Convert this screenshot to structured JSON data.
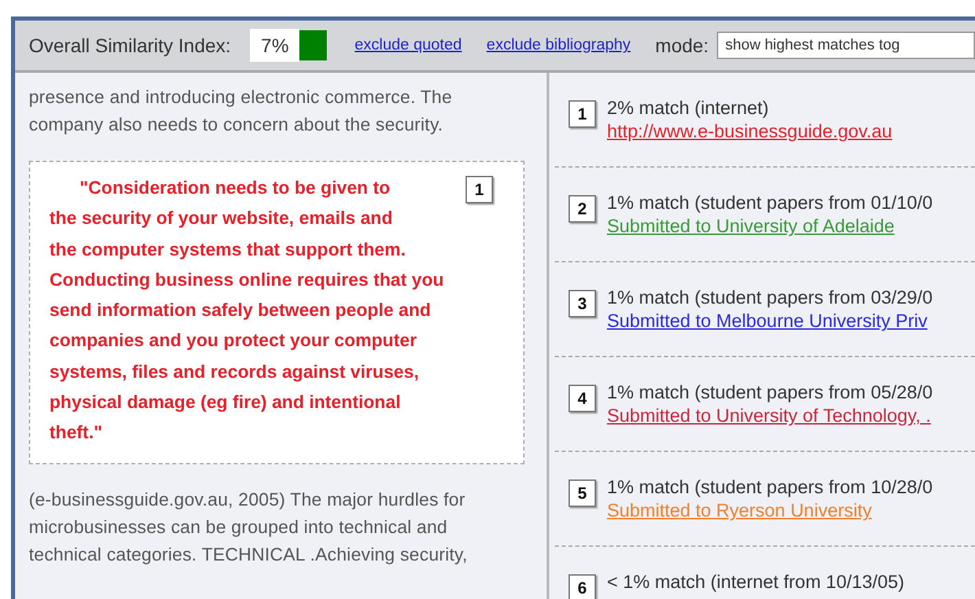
{
  "header": {
    "label": "Overall Similarity Index:",
    "index_value": "7%",
    "links": [
      "exclude quoted",
      "exclude bibliography"
    ],
    "mode_label": "mode:",
    "mode_value": "show highest matches tog"
  },
  "document": [
    {
      "kind": "text",
      "text": "presence and introducing electronic commerce. The\ncompany also needs to concern about the security."
    },
    {
      "kind": "quote",
      "number": "1",
      "color": "#e8202a",
      "text": "\"Consideration needs to be given to\nthe security of your website, emails and\nthe computer systems that support them.\nConducting business online requires that you\nsend information safely between people and\ncompanies and you protect your computer\nsystems, files and records against viruses,\nphysical damage (eg fire) and intentional\ntheft.\""
    },
    {
      "kind": "text",
      "text": "(e-businessguide.gov.au, 2005) The major hurdles for\nmicrobusinesses can be grouped into technical and\ntechnical categories. TECHNICAL .Achieving security,"
    }
  ],
  "matches": [
    {
      "number": "1",
      "summary": "2% match (internet)",
      "source": "http://www.e-businessguide.gov.au",
      "color": "#e8202a"
    },
    {
      "number": "2",
      "summary": "1% match (student papers from 01/10/0",
      "source": "Submitted to University of Adelaide",
      "color": "#3a9a3a"
    },
    {
      "number": "3",
      "summary": "1% match (student papers from 03/29/0",
      "source": "Submitted to Melbourne University Priv",
      "color": "#2a2ae0"
    },
    {
      "number": "4",
      "summary": "1% match (student papers from 05/28/0",
      "source": "Submitted to University of Technology, .",
      "color": "#c8283c"
    },
    {
      "number": "5",
      "summary": "1% match (student papers from 10/28/0",
      "source": "Submitted to Ryerson University",
      "color": "#f08030"
    },
    {
      "number": "6",
      "summary": "< 1% match (internet from 10/13/05)"
    }
  ]
}
